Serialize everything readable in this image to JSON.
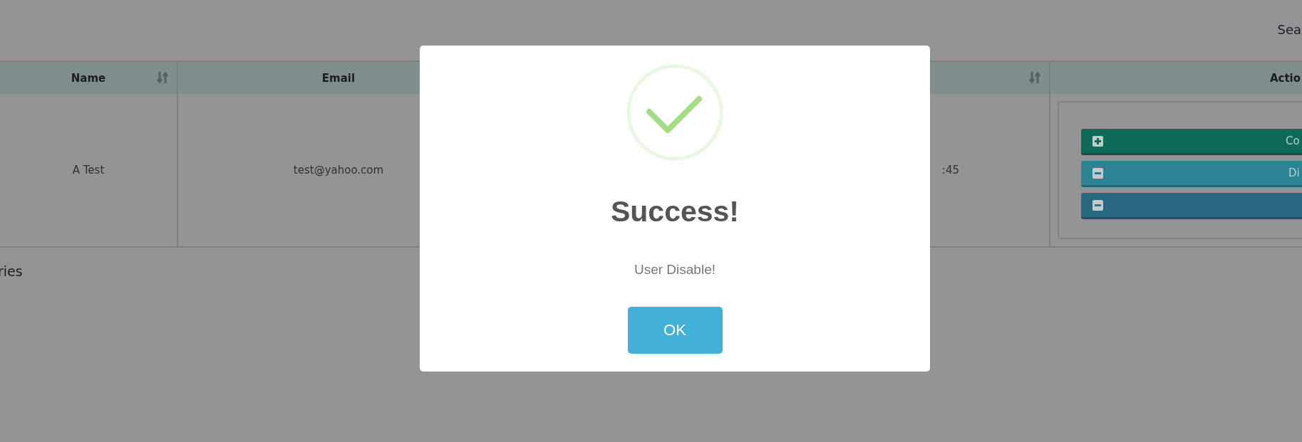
{
  "search": {
    "label": "Sea"
  },
  "table": {
    "columns": [
      {
        "label": "Name",
        "sortable": true
      },
      {
        "label": "Email"
      },
      {
        "sortable": true
      },
      {
        "label": "Actio"
      }
    ],
    "rows": [
      {
        "cells": [
          "A Test",
          "test@yahoo.com",
          ":45"
        ],
        "actions": [
          {
            "kind": "add",
            "label": "Co",
            "color": "#106a5c"
          },
          {
            "kind": "remove",
            "label": "Di",
            "color": "#2b8393"
          },
          {
            "kind": "remove",
            "color": "#276880"
          }
        ]
      }
    ]
  },
  "footer": {
    "text": "ries"
  },
  "dialog": {
    "kind": "success",
    "title": "Success!",
    "message": "User Disable!",
    "button": "OK"
  }
}
